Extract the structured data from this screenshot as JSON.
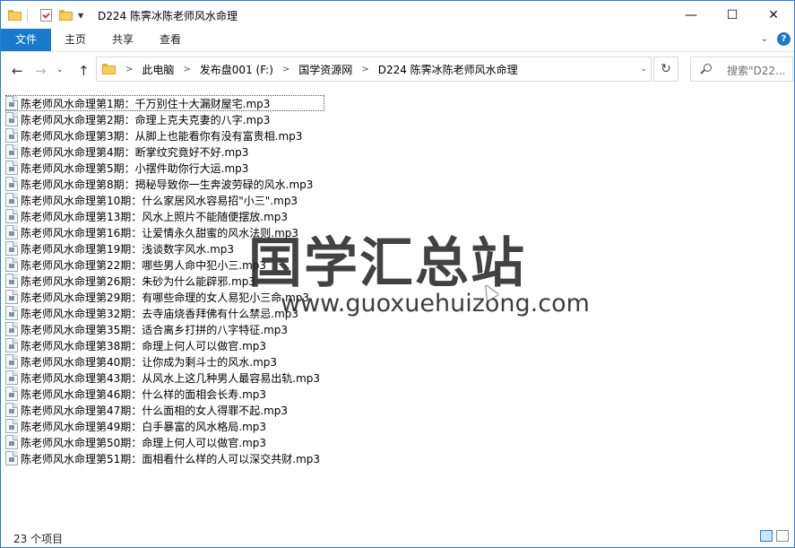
{
  "window": {
    "title": "D224 陈霁冰陈老师风水命理"
  },
  "caption": {
    "minimize": "—",
    "maximize": "☐",
    "close": "✕"
  },
  "ribbon": {
    "tabs": [
      "文件",
      "主页",
      "共享",
      "查看"
    ],
    "help": "?"
  },
  "nav": {
    "breadcrumbs": [
      "此电脑",
      "发布盘001 (F:)",
      "国学资源网",
      "D224 陈霁冰陈老师风水命理"
    ],
    "search_placeholder": "搜索\"D22..."
  },
  "files": [
    "陈老师风水命理第1期：千万别住十大漏财屋宅.mp3",
    "陈老师风水命理第2期：命理上克夫克妻的八字.mp3",
    "陈老师风水命理第3期：从脚上也能看你有没有富贵相.mp3",
    "陈老师风水命理第4期：断掌纹究竟好不好.mp3",
    "陈老师风水命理第5期：小摆件助你行大运.mp3",
    "陈老师风水命理第8期：揭秘导致你一生奔波劳碌的风水.mp3",
    "陈老师风水命理第10期：什么家居风水容易招\"小三\".mp3",
    "陈老师风水命理第13期：风水上照片不能随便摆放.mp3",
    "陈老师风水命理第16期：让爱情永久甜蜜的风水法则.mp3",
    "陈老师风水命理第19期：浅谈数字风水.mp3",
    "陈老师风水命理第22期：哪些男人命中犯小三.mp3",
    "陈老师风水命理第26期：朱砂为什么能辟邪.mp3",
    "陈老师风水命理第29期：有哪些命理的女人易犯小三命.mp3",
    "陈老师风水命理第32期：去寺庙烧香拜佛有什么禁忌.mp3",
    "陈老师风水命理第35期：适合离乡打拼的八字特征.mp3",
    "陈老师风水命理第38期：命理上何人可以做官.mp3",
    "陈老师风水命理第40期：让你成为剩斗士的风水.mp3",
    "陈老师风水命理第43期：从风水上这几种男人最容易出轨.mp3",
    "陈老师风水命理第46期：什么样的面相会长寿.mp3",
    "陈老师风水命理第47期：什么面相的女人得罪不起.mp3",
    "陈老师风水命理第49期：白手暴富的风水格局.mp3",
    "陈老师风水命理第50期：命理上何人可以做官.mp3",
    "陈老师风水命理第51期：面相看什么样的人可以深交共财.mp3"
  ],
  "watermark": {
    "text": "国学汇总站",
    "url": "www.guoxuehuizong.com"
  },
  "status": {
    "item_count": "23 个项目"
  },
  "colors": {
    "accent": "#1979ca",
    "border": "#2b7bd8"
  }
}
